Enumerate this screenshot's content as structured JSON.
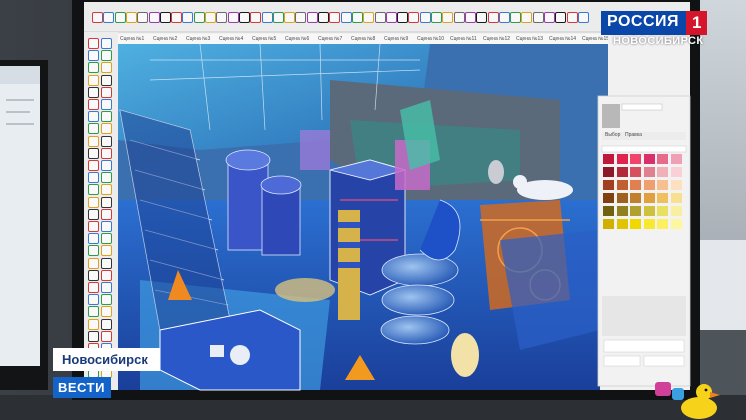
{
  "modeling_app": {
    "model_tabs": [
      "Сцена №1",
      "Сцена №2",
      "Сцена №3",
      "Сцена №4",
      "Сцена №5",
      "Сцена №6",
      "Сцена №7",
      "Сцена №8",
      "Сцена №9",
      "Сцена №10",
      "Сцена №11",
      "Сцена №12",
      "Сцена №13",
      "Сцена №14",
      "Сцена №15"
    ],
    "materials_panel": {
      "tabs": [
        "Выбор",
        "Правка"
      ],
      "swatch_colors": [
        "#c0183a",
        "#e0244e",
        "#f0446a",
        "#d8306a",
        "#e86a8a",
        "#f0a0b4",
        "#8a1a2a",
        "#b02a3a",
        "#d65060",
        "#e08090",
        "#f0b0b8",
        "#f8d0d6",
        "#a04020",
        "#c06030",
        "#e08050",
        "#f0a070",
        "#f8c090",
        "#fce0c0",
        "#804010",
        "#a06020",
        "#c08030",
        "#e0a040",
        "#f0c060",
        "#f8e090",
        "#706010",
        "#908020",
        "#b0a030",
        "#d0c040",
        "#e8e060",
        "#f8f0a0",
        "#d0b000",
        "#e0c400",
        "#f0d800",
        "#f8e830",
        "#fcf060",
        "#fdf8a0"
      ]
    }
  },
  "broadcast": {
    "channel_name": "РОССИЯ",
    "channel_number": "1",
    "region_subtitle": "НОВОСИБИРСК",
    "location_caption": "Новосибирск",
    "program_logo": "ВЕСТИ",
    "colors": {
      "channel_blue": "#0b47a8",
      "channel_red": "#d5162a",
      "vesti_blue": "#1463c8"
    }
  },
  "props": [
    "rubber-duck-toy"
  ]
}
